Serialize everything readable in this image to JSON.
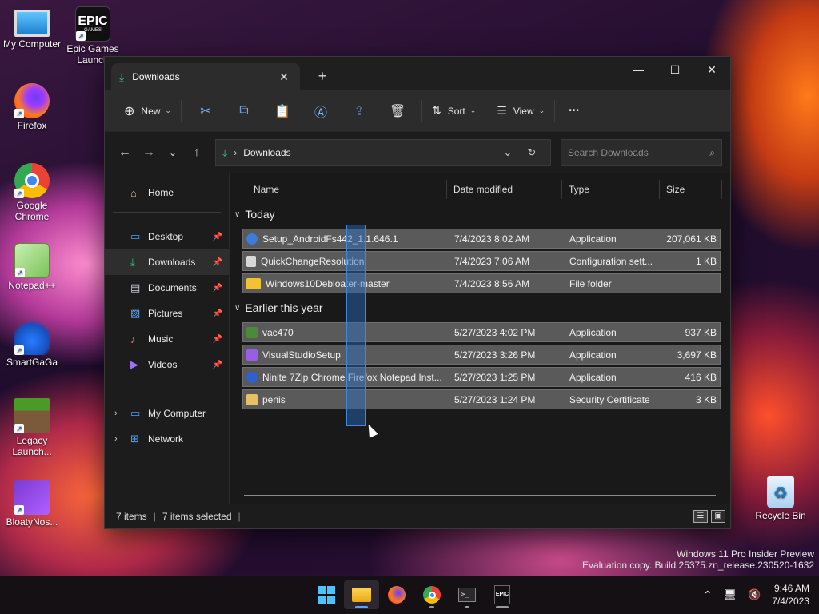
{
  "desktop": {
    "icons": [
      {
        "label": "My Computer",
        "icon": "monitor-icon"
      },
      {
        "label": "Epic Games Launch",
        "icon": "epic-games-icon"
      },
      {
        "label": "Firefox",
        "icon": "firefox-icon"
      },
      {
        "label": "Google Chrome",
        "icon": "chrome-icon"
      },
      {
        "label": "Notepad++",
        "icon": "notepadpp-icon"
      },
      {
        "label": "SmartGaGa",
        "icon": "smartgaga-icon"
      },
      {
        "label": "Legacy Launch...",
        "icon": "minecraft-icon"
      },
      {
        "label": "BloatyNos...",
        "icon": "bloatynosy-icon"
      },
      {
        "label": "Recycle Bin",
        "icon": "recycle-bin-icon"
      }
    ],
    "epic_logo_text": "EPIC",
    "epic_logo_sub": "GAMES"
  },
  "window": {
    "tab_title": "Downloads",
    "new_tab": "+",
    "controls": {
      "minimize": "—",
      "maximize": "☐",
      "close": "✕"
    }
  },
  "toolbar": {
    "new_label": "New",
    "sort_label": "Sort",
    "view_label": "View",
    "more_label": "•••"
  },
  "address": {
    "location": "Downloads",
    "search_placeholder": "Search Downloads"
  },
  "sidebar": {
    "home": "Home",
    "items": [
      {
        "label": "Desktop",
        "icon": "desktop-icon",
        "color": "#4aa3ff"
      },
      {
        "label": "Downloads",
        "icon": "download-icon",
        "color": "#2ec27e"
      },
      {
        "label": "Documents",
        "icon": "document-icon",
        "color": "#cfd8e6"
      },
      {
        "label": "Pictures",
        "icon": "picture-icon",
        "color": "#5fb0ff"
      },
      {
        "label": "Music",
        "icon": "music-icon",
        "color": "#ff6a5a"
      },
      {
        "label": "Videos",
        "icon": "video-icon",
        "color": "#a070ff"
      }
    ],
    "my_computer": "My Computer",
    "network": "Network"
  },
  "columns": {
    "name": "Name",
    "date": "Date modified",
    "type": "Type",
    "size": "Size"
  },
  "groups": {
    "today": {
      "label": "Today",
      "rows": [
        {
          "name": "Setup_AndroidFs442_1.1.646.1",
          "date": "7/4/2023 8:02 AM",
          "type": "Application",
          "size": "207,061 KB",
          "icon_color": "#3b7dd8"
        },
        {
          "name": "QuickChangeResolution",
          "date": "7/4/2023 7:06 AM",
          "type": "Configuration sett...",
          "size": "1 KB",
          "icon_color": "#d8d8d8"
        },
        {
          "name": "Windows10Debloater-master",
          "date": "7/4/2023 8:56 AM",
          "type": "File folder",
          "size": "",
          "icon_color": "#f2c230"
        }
      ]
    },
    "earlier": {
      "label": "Earlier this year",
      "rows": [
        {
          "name": "vac470",
          "date": "5/27/2023 4:02 PM",
          "type": "Application",
          "size": "937 KB",
          "icon_color": "#4a8a3a"
        },
        {
          "name": "VisualStudioSetup",
          "date": "5/27/2023 3:26 PM",
          "type": "Application",
          "size": "3,697 KB",
          "icon_color": "#9b5de5"
        },
        {
          "name": "Ninite 7Zip Chrome Firefox Notepad Inst...",
          "date": "5/27/2023 1:25 PM",
          "type": "Application",
          "size": "416 KB",
          "icon_color": "#2f5fd0"
        },
        {
          "name": "penis",
          "date": "5/27/2023 1:24 PM",
          "type": "Security Certificate",
          "size": "3 KB",
          "icon_color": "#e8c060"
        }
      ]
    }
  },
  "status": {
    "items": "7 items",
    "selected": "7 items selected"
  },
  "watermark": {
    "line1": "Windows 11 Pro Insider Preview",
    "line2": "Evaluation copy. Build 25375.zn_release.230520-1632"
  },
  "taskbar": {
    "time": "9:46 AM",
    "date": "7/4/2023"
  }
}
